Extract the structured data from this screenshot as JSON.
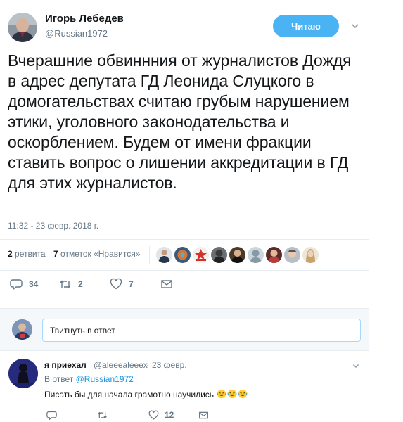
{
  "tweet": {
    "author_name": "Игорь Лебедев",
    "author_handle": "@Russian1972",
    "follow_label": "Читаю",
    "text": "Вчерашние обвиннния от журналистов Дождя в адрес депутата ГД Леонида Слуцкого в домогательствах считаю грубым нарушением этики, уголовного законодательства и оскорблением. Будем от имени фракции ставить вопрос о лишении аккредитации в ГД для этих журналистов.",
    "timestamp": "11:32 - 23 февр. 2018 г.",
    "retweets_count": "2",
    "retweets_label": "ретвита",
    "likes_count": "7",
    "likes_label": "отметок «Нравится»",
    "actions": {
      "reply_count": "34",
      "retweet_count": "2",
      "like_count": "7"
    }
  },
  "reply_box": {
    "placeholder": "Твитнуть в ответ"
  },
  "reply": {
    "name": "я приехал",
    "handle": "@aleeealeeex",
    "dot": "·",
    "date": "23 февр.",
    "in_reply_prefix": "В ответ",
    "in_reply_handle": "@Russian1972",
    "text": "Писать бы для начала грамотно научились",
    "emoji": "laughing-tears",
    "actions": {
      "reply_count": "",
      "retweet_count": "",
      "like_count": "12"
    }
  },
  "colors": {
    "accent": "#4ab3f4",
    "link": "#1b95e0",
    "muted": "#657786"
  }
}
